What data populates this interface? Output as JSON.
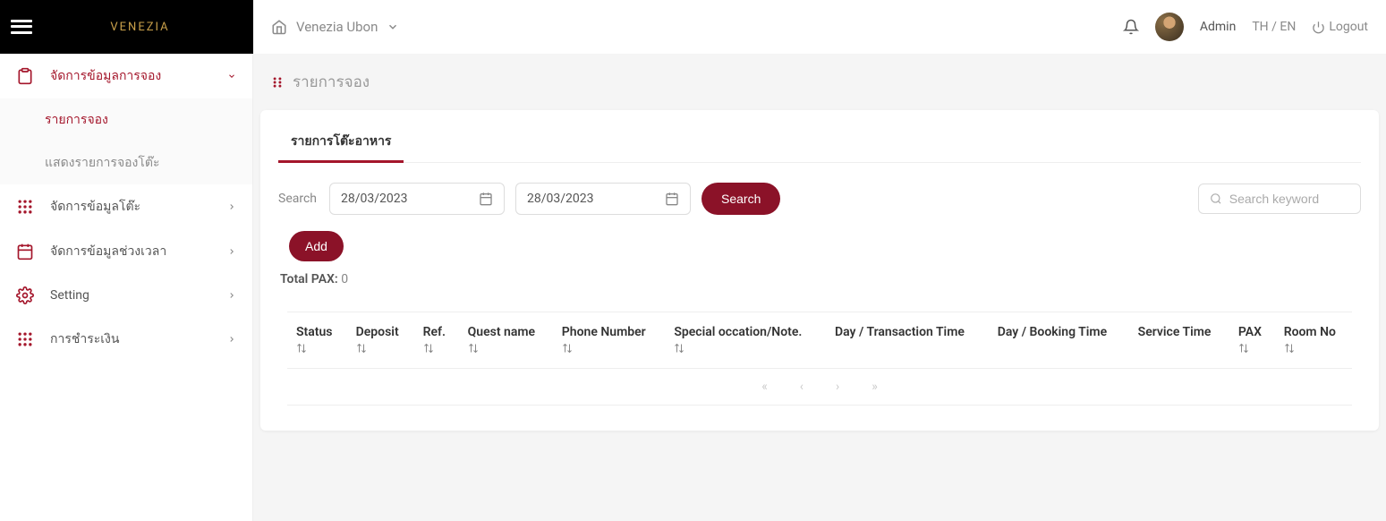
{
  "brand": {
    "name": "VENEZIA"
  },
  "header": {
    "location": "Venezia Ubon",
    "user": "Admin",
    "lang": "TH / EN",
    "logout": "Logout"
  },
  "sidebar": {
    "items": [
      {
        "label": "จัดการข้อมูลการจอง",
        "expanded": true
      },
      {
        "label": "จัดการข้อมูลโต๊ะ",
        "expanded": false
      },
      {
        "label": "จัดการข้อมูลช่วงเวลา",
        "expanded": false
      },
      {
        "label": "Setting",
        "expanded": false
      },
      {
        "label": "การชำระเงิน",
        "expanded": false
      }
    ],
    "subitems": [
      {
        "label": "รายการจอง",
        "active": true
      },
      {
        "label": "แสดงรายการจองโต๊ะ",
        "active": false
      }
    ]
  },
  "page": {
    "title": "รายการจอง",
    "tab": "รายการโต๊ะอาหาร"
  },
  "search": {
    "label": "Search",
    "date_from": "28/03/2023",
    "date_to": "28/03/2023",
    "button": "Search",
    "keyword_placeholder": "Search keyword"
  },
  "actions": {
    "add": "Add"
  },
  "summary": {
    "total_pax_label": "Total PAX:",
    "total_pax_value": "0"
  },
  "table": {
    "columns": [
      "Status",
      "Deposit",
      "Ref.",
      "Quest name",
      "Phone Number",
      "Special occation/Note.",
      "Day / Transaction Time",
      "Day / Booking Time",
      "Service Time",
      "PAX",
      "Room No"
    ],
    "sortable": [
      true,
      true,
      true,
      true,
      true,
      true,
      false,
      false,
      false,
      true,
      true
    ],
    "rows": []
  }
}
